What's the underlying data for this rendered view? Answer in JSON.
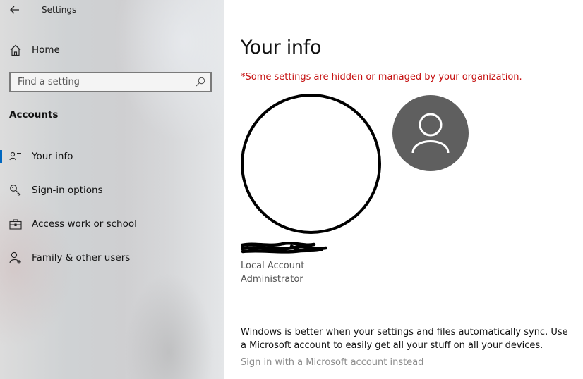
{
  "window": {
    "title": "Settings"
  },
  "sidebar": {
    "home_label": "Home",
    "search": {
      "placeholder": "Find a setting",
      "value": ""
    },
    "section_title": "Accounts",
    "items": [
      {
        "label": "Your info",
        "icon": "your-info-icon",
        "selected": true
      },
      {
        "label": "Sign-in options",
        "icon": "key-icon",
        "selected": false
      },
      {
        "label": "Access work or school",
        "icon": "briefcase-icon",
        "selected": false
      },
      {
        "label": "Family & other users",
        "icon": "person-add-icon",
        "selected": false
      }
    ]
  },
  "main": {
    "title": "Your info",
    "warning": "*Some settings are hidden or managed by your organization.",
    "account": {
      "type": "Local Account",
      "role": "Administrator"
    },
    "sync_message": "Windows is better when your settings and files automatically sync. Use a Microsoft account to easily get all your stuff on all your devices.",
    "microsoft_signin_link": "Sign in with a Microsoft account instead"
  },
  "colors": {
    "accent": "#0067c0",
    "warning": "#c50f0f",
    "avatar_bg": "#5f5f5f",
    "disabled_link": "#8c8c8c"
  }
}
